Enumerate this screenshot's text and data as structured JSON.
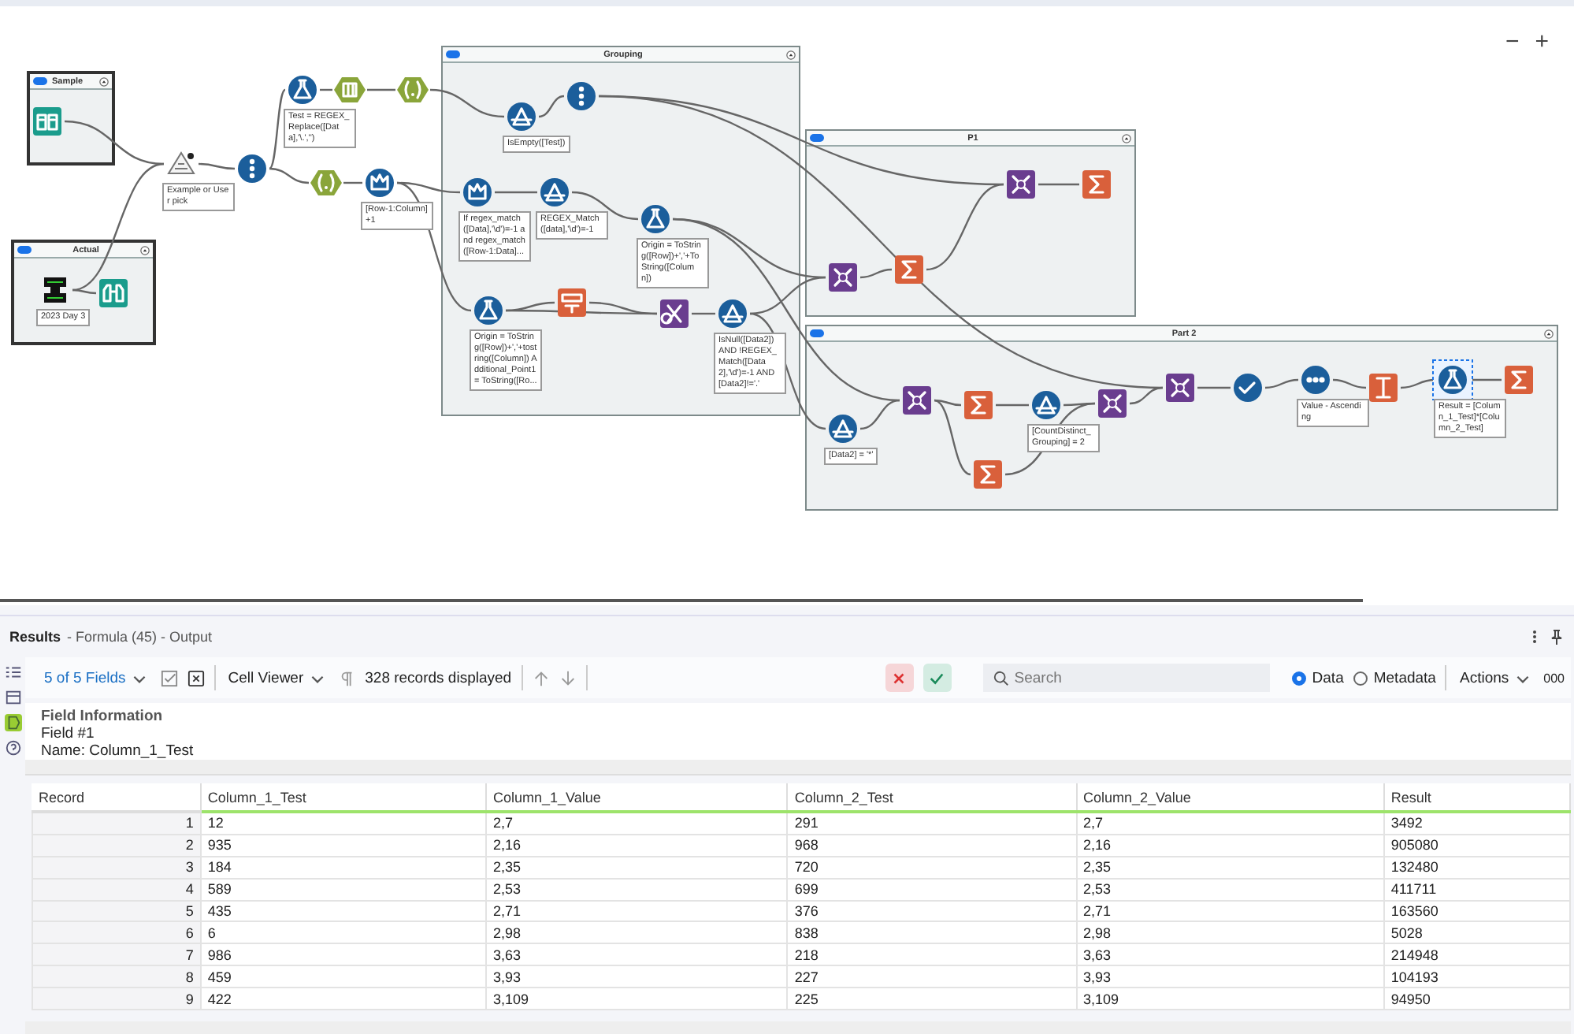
{
  "canvas": {
    "zoom_controls": [
      "−",
      "+"
    ],
    "containers": [
      {
        "title": "Sample",
        "enabled": true
      },
      {
        "title": "Actual",
        "enabled": true
      },
      {
        "title": "Grouping",
        "enabled": true
      },
      {
        "title": "P1",
        "enabled": true
      },
      {
        "title": "Part 2",
        "enabled": true
      }
    ],
    "tools": [
      {
        "kind": "input",
        "selected": false
      },
      {
        "kind": "condition",
        "annotation": "Example or User pick",
        "selected": false
      },
      {
        "kind": "sample",
        "selected": false
      },
      {
        "kind": "formula",
        "annotation": "Test = REGEX_Replace([Data],'\\.','')",
        "selected": false
      },
      {
        "kind": "text-to-columns",
        "selected": false
      },
      {
        "kind": "regex",
        "selected": false
      },
      {
        "kind": "regex",
        "selected": false
      },
      {
        "kind": "multirow",
        "annotation": "[Row-1:Column]+1",
        "selected": false
      },
      {
        "kind": "text-input",
        "annotation": "2023 Day 3",
        "selected": false
      },
      {
        "kind": "browse",
        "selected": false
      },
      {
        "kind": "filter",
        "annotation": "IsEmpty([Test])",
        "selected": false
      },
      {
        "kind": "sample",
        "selected": false
      },
      {
        "kind": "multirow",
        "annotation": "If regex_match([Data],'\\d')=-1 and regex_match([Row-1:Data]...",
        "selected": false
      },
      {
        "kind": "filter",
        "annotation": "REGEX_Match([data],'\\d')=-1",
        "selected": false
      },
      {
        "kind": "formula",
        "annotation": "Origin = ToString([Row])+','+ToString([Column])",
        "selected": false
      },
      {
        "kind": "formula",
        "annotation": "Origin = ToString([Row])+','+tostring([Column]) Additional_Point1 = ToString([Ro...",
        "selected": false
      },
      {
        "kind": "generate",
        "selected": false
      },
      {
        "kind": "find-replace",
        "selected": false
      },
      {
        "kind": "filter",
        "annotation": "IsNull([Data2]) AND !REGEX_Match([Data2],'\\d')=-1 AND [Data2]!='.'",
        "selected": false
      },
      {
        "kind": "join",
        "selected": false
      },
      {
        "kind": "summarize",
        "selected": false
      },
      {
        "kind": "join",
        "selected": false
      },
      {
        "kind": "summarize",
        "selected": false
      },
      {
        "kind": "filter",
        "annotation": "[Data2] = '*'",
        "selected": false
      },
      {
        "kind": "join",
        "selected": false
      },
      {
        "kind": "summarize",
        "selected": false
      },
      {
        "kind": "filter",
        "annotation": "[CountDistinct_Grouping] = 2",
        "selected": false
      },
      {
        "kind": "join",
        "selected": false
      },
      {
        "kind": "summarize",
        "selected": false
      },
      {
        "kind": "join",
        "selected": false
      },
      {
        "kind": "unique",
        "selected": false
      },
      {
        "kind": "sort",
        "annotation": "Value - Ascending",
        "selected": false
      },
      {
        "kind": "union",
        "selected": false
      },
      {
        "kind": "formula",
        "annotation": "Result = [Column_1_Test]*[Column_2_Test]",
        "selected": true
      },
      {
        "kind": "summarize",
        "selected": false
      }
    ]
  },
  "results": {
    "title": "Results",
    "subtitle": "- Formula (45) - Output",
    "side_tabs": [
      {
        "selected": false
      },
      {
        "selected": false
      },
      {
        "selected": true
      },
      {
        "selected": false
      }
    ],
    "toolbar": {
      "fields": "5 of 5 Fields",
      "viewer": "Cell Viewer",
      "records": "328 records displayed",
      "search": {
        "placeholder": "Search"
      },
      "view_options": [
        {
          "label": "Data",
          "selected": true
        },
        {
          "label": "Metadata",
          "selected": false
        }
      ],
      "actions": "Actions",
      "more": "000"
    },
    "field_info": {
      "heading": "Field Information",
      "lines": [
        "Field #1",
        "Name: Column_1_Test"
      ]
    },
    "table": {
      "columns": [
        "Record",
        "Column_1_Test",
        "Column_1_Value",
        "Column_2_Test",
        "Column_2_Value",
        "Result"
      ],
      "rows": [
        [
          "1",
          "12",
          "2,7",
          "291",
          "2,7",
          "3492"
        ],
        [
          "2",
          "935",
          "2,16",
          "968",
          "2,16",
          "905080"
        ],
        [
          "3",
          "184",
          "2,35",
          "720",
          "2,35",
          "132480"
        ],
        [
          "4",
          "589",
          "2,53",
          "699",
          "2,53",
          "411711"
        ],
        [
          "5",
          "435",
          "2,71",
          "376",
          "2,71",
          "163560"
        ],
        [
          "6",
          "6",
          "2,98",
          "838",
          "2,98",
          "5028"
        ],
        [
          "7",
          "986",
          "3,63",
          "218",
          "3,63",
          "214948"
        ],
        [
          "8",
          "459",
          "3,93",
          "227",
          "3,93",
          "104193"
        ],
        [
          "9",
          "422",
          "3,109",
          "225",
          "3,109",
          "94950"
        ]
      ]
    }
  }
}
